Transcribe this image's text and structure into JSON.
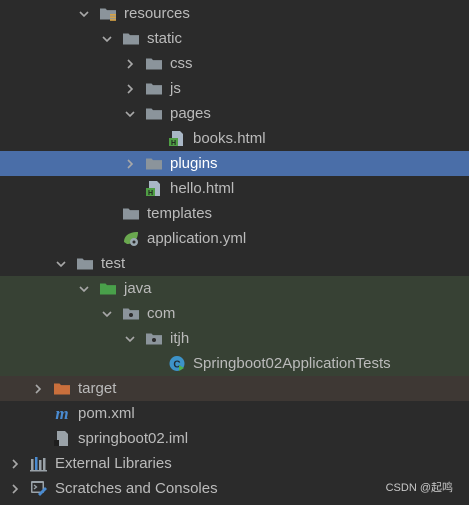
{
  "tree": {
    "items": [
      {
        "label": "resources",
        "depth": 3,
        "expanded": true,
        "icon": "resources-folder-icon"
      },
      {
        "label": "static",
        "depth": 4,
        "expanded": true,
        "icon": "folder-icon"
      },
      {
        "label": "css",
        "depth": 5,
        "expanded": false,
        "icon": "folder-icon"
      },
      {
        "label": "js",
        "depth": 5,
        "expanded": false,
        "icon": "folder-icon"
      },
      {
        "label": "pages",
        "depth": 5,
        "expanded": true,
        "icon": "folder-icon"
      },
      {
        "label": "books.html",
        "depth": 6,
        "icon": "html-file-icon"
      },
      {
        "label": "plugins",
        "depth": 5,
        "expanded": false,
        "icon": "folder-icon",
        "selected": true
      },
      {
        "label": "hello.html",
        "depth": 5,
        "icon": "html-file-icon"
      },
      {
        "label": "templates",
        "depth": 4,
        "icon": "folder-icon"
      },
      {
        "label": "application.yml",
        "depth": 4,
        "icon": "spring-config-icon"
      },
      {
        "label": "test",
        "depth": 2,
        "expanded": true,
        "icon": "folder-icon"
      },
      {
        "label": "java",
        "depth": 3,
        "expanded": true,
        "icon": "test-sources-folder-icon",
        "background": "test"
      },
      {
        "label": "com",
        "depth": 4,
        "expanded": true,
        "icon": "package-icon",
        "background": "test"
      },
      {
        "label": "itjh",
        "depth": 5,
        "expanded": true,
        "icon": "package-icon",
        "background": "test"
      },
      {
        "label": "Springboot02ApplicationTests",
        "depth": 6,
        "icon": "test-class-icon",
        "background": "test"
      },
      {
        "label": "target",
        "depth": 1,
        "expanded": false,
        "icon": "excluded-folder-icon",
        "background": "excluded"
      },
      {
        "label": "pom.xml",
        "depth": 1,
        "icon": "maven-icon"
      },
      {
        "label": "springboot02.iml",
        "depth": 1,
        "icon": "iml-file-icon"
      },
      {
        "label": "External Libraries",
        "depth": 0,
        "expanded": false,
        "icon": "libraries-icon"
      },
      {
        "label": "Scratches and Consoles",
        "depth": 0,
        "expanded": false,
        "icon": "scratches-icon"
      }
    ]
  },
  "watermark": "CSDN @起鸣",
  "colors": {
    "background": "#2b2b2b",
    "selected_row": "#4a6ea8",
    "test_row": "#374134",
    "excluded_row": "#3e3834",
    "folder": "#8b949b",
    "test_folder": "#49a04a",
    "excluded_folder": "#c96f3c",
    "text": "#bbbbbb"
  }
}
